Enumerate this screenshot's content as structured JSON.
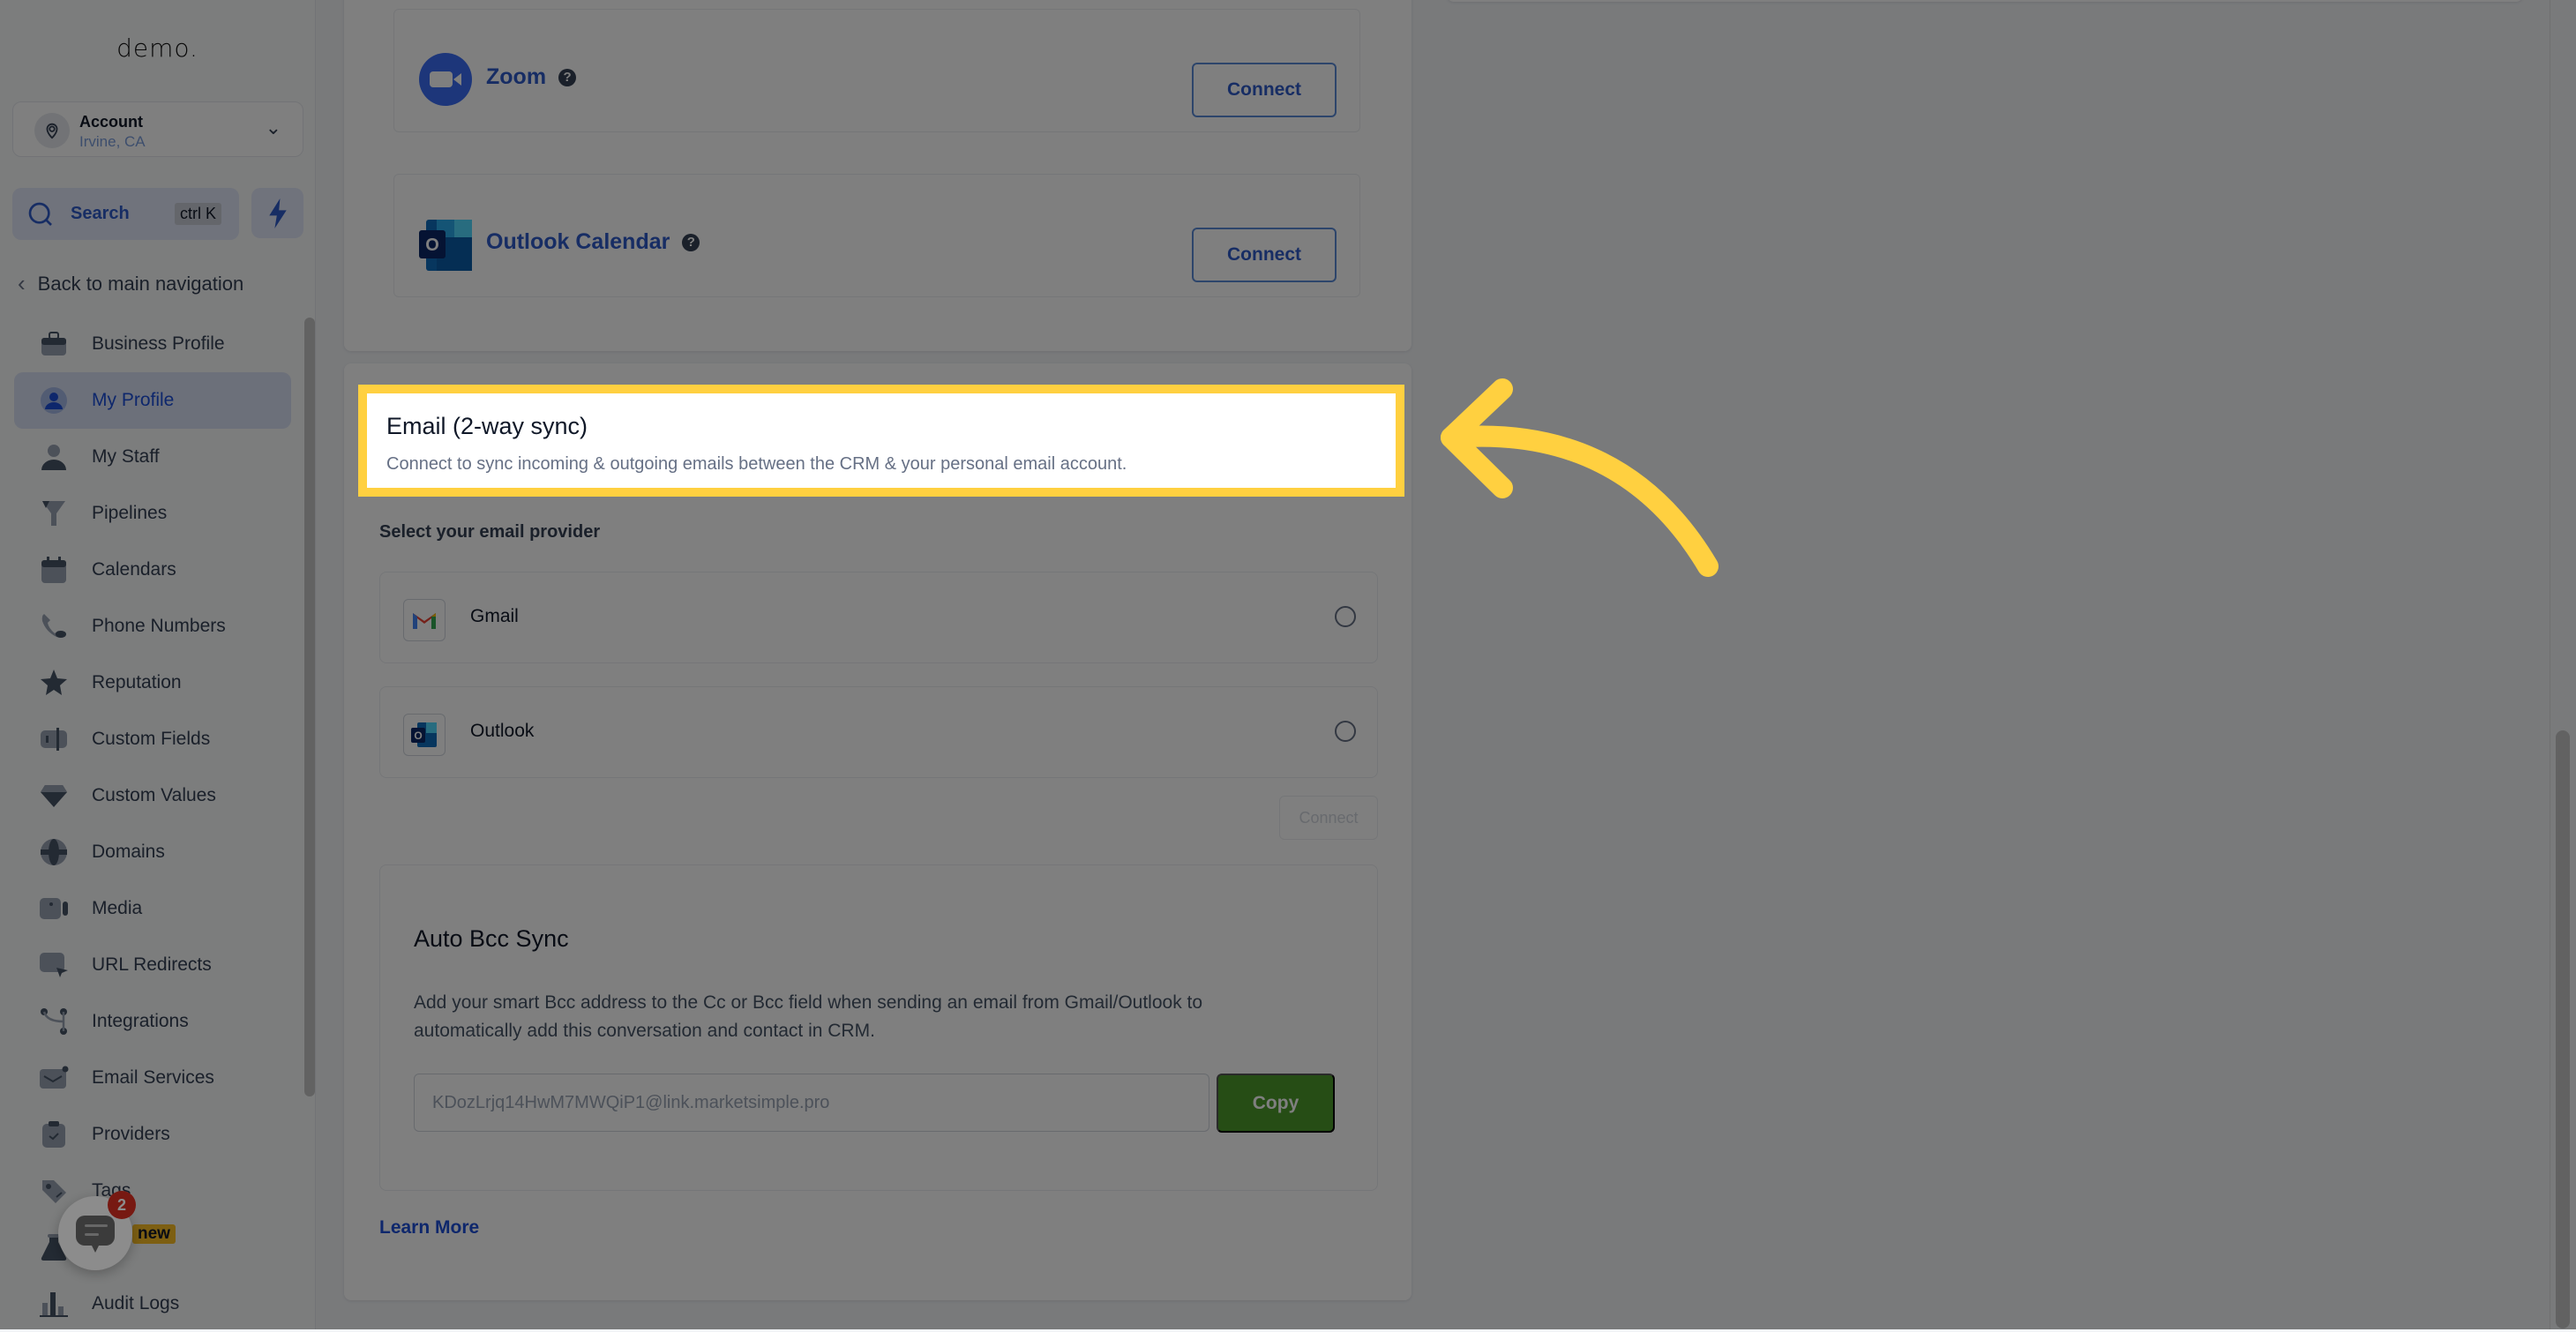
{
  "sidebar": {
    "logo": "demo.",
    "account": {
      "name": "Account",
      "location": "Irvine, CA"
    },
    "search": {
      "label": "Search",
      "shortcut": "ctrl K"
    },
    "back_label": "Back to main navigation",
    "items": [
      {
        "label": "Business Profile",
        "icon": "briefcase-icon"
      },
      {
        "label": "My Profile",
        "icon": "user-circle-icon",
        "active": true
      },
      {
        "label": "My Staff",
        "icon": "user-icon"
      },
      {
        "label": "Pipelines",
        "icon": "funnel-icon"
      },
      {
        "label": "Calendars",
        "icon": "calendar-icon"
      },
      {
        "label": "Phone Numbers",
        "icon": "phone-icon"
      },
      {
        "label": "Reputation",
        "icon": "star-icon"
      },
      {
        "label": "Custom Fields",
        "icon": "input-field-icon"
      },
      {
        "label": "Custom Values",
        "icon": "gem-icon"
      },
      {
        "label": "Domains",
        "icon": "globe-icon"
      },
      {
        "label": "Media",
        "icon": "video-icon"
      },
      {
        "label": "URL Redirects",
        "icon": "redirect-icon"
      },
      {
        "label": "Integrations",
        "icon": "branch-icon"
      },
      {
        "label": "Email Services",
        "icon": "mail-icon"
      },
      {
        "label": "Providers",
        "icon": "clipboard-check-icon"
      },
      {
        "label": "Tags",
        "icon": "tag-icon"
      },
      {
        "label": "",
        "icon": "flask-icon"
      },
      {
        "label": "Audit Logs",
        "icon": "bar-chart-icon"
      }
    ],
    "new_badge": "new",
    "chat_count": "2"
  },
  "integrations": [
    {
      "name": "Zoom",
      "button": "Connect"
    },
    {
      "name": "Outlook Calendar",
      "button": "Connect"
    }
  ],
  "email_section": {
    "title": "Email (2-way sync)",
    "subtitle": "Connect to sync incoming & outgoing emails between the CRM & your personal email account.",
    "provider_label": "Select your email provider",
    "providers": [
      {
        "name": "Gmail",
        "selected": false
      },
      {
        "name": "Outlook",
        "selected": false
      }
    ],
    "connect_button": "Connect"
  },
  "auto_bcc": {
    "title": "Auto Bcc Sync",
    "description": "Add your smart Bcc address to the Cc or Bcc field when sending an email from Gmail/Outlook to automatically add this conversation and contact in CRM.",
    "address": "KDozLrjq14HwM7MWQiP1@link.marketsimple.pro",
    "copy_button": "Copy"
  },
  "learn_more": "Learn More",
  "colors": {
    "accent": "#2f5ac9",
    "highlight": "#ffd040",
    "copy_button": "#4c9a2a",
    "badge_new": "#fbbf24",
    "chat_badge": "#d92d20"
  }
}
